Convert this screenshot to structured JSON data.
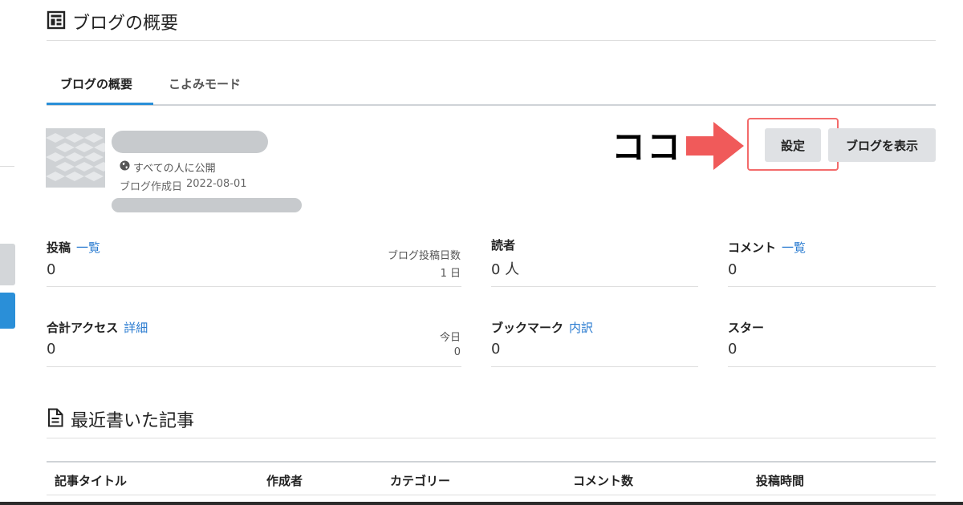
{
  "page": {
    "title": "ブログの概要"
  },
  "tabs": [
    {
      "label": "ブログの概要",
      "active": true
    },
    {
      "label": "こよみモード",
      "active": false
    }
  ],
  "blog": {
    "visibility": "すべての人に公開",
    "created_label": "ブログ作成日",
    "created_date": "2022-08-01"
  },
  "annotation": {
    "text": "ココ",
    "color": "#f05a5a"
  },
  "buttons": {
    "settings": "設定",
    "view_blog": "ブログを表示"
  },
  "stats": {
    "posts": {
      "label": "投稿",
      "link": "一覧",
      "value": "0",
      "sub_label": "ブログ投稿日数",
      "sub_value": "1 日"
    },
    "readers": {
      "label": "読者",
      "value": "0 人"
    },
    "comments": {
      "label": "コメント",
      "link": "一覧",
      "value": "0"
    },
    "access": {
      "label": "合計アクセス",
      "link": "詳細",
      "value": "0",
      "sub_label": "今日",
      "sub_value": "0"
    },
    "bookmarks": {
      "label": "ブックマーク",
      "link": "内訳",
      "value": "0"
    },
    "stars": {
      "label": "スター",
      "value": "0"
    }
  },
  "recent": {
    "title": "最近書いた記事",
    "columns": [
      "記事タイトル",
      "作成者",
      "カテゴリー",
      "コメント数",
      "投稿時間"
    ]
  },
  "colors": {
    "accent": "#2a8fd8",
    "link": "#2a7bd0",
    "annotation_red": "#f05a5a"
  }
}
